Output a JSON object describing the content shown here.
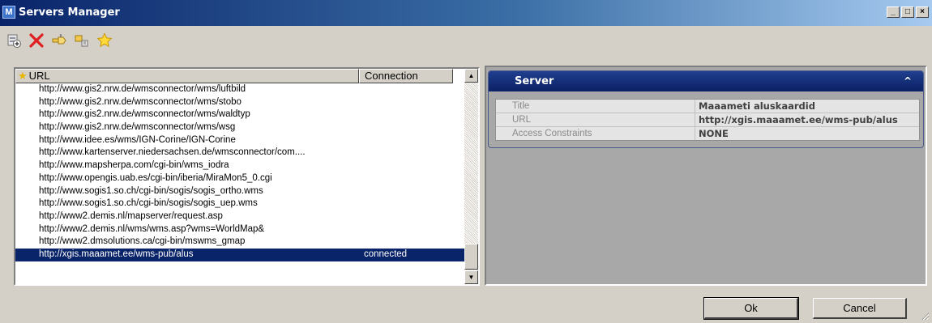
{
  "window": {
    "title": "Servers Manager",
    "controls": [
      "_",
      "□",
      "×"
    ]
  },
  "toolbar": {
    "buttons": [
      {
        "name": "add-server",
        "icon": "add-server-icon"
      },
      {
        "name": "delete-server",
        "icon": "delete-x-icon"
      },
      {
        "name": "connect",
        "icon": "connect-icon"
      },
      {
        "name": "disconnect",
        "icon": "disconnect-icon"
      },
      {
        "name": "favorite",
        "icon": "star-icon"
      }
    ]
  },
  "server_list": {
    "columns": {
      "url": "URL",
      "connection": "Connection"
    },
    "rows": [
      {
        "url": "http://www.gis2.nrw.de/wmsconnector/wms/luftbild",
        "connection": ""
      },
      {
        "url": "http://www.gis2.nrw.de/wmsconnector/wms/stobo",
        "connection": ""
      },
      {
        "url": "http://www.gis2.nrw.de/wmsconnector/wms/waldtyp",
        "connection": ""
      },
      {
        "url": "http://www.gis2.nrw.de/wmsconnector/wms/wsg",
        "connection": ""
      },
      {
        "url": "http://www.idee.es/wms/IGN-Corine/IGN-Corine",
        "connection": ""
      },
      {
        "url": "http://www.kartenserver.niedersachsen.de/wmsconnector/com....",
        "connection": ""
      },
      {
        "url": "http://www.mapsherpa.com/cgi-bin/wms_iodra",
        "connection": ""
      },
      {
        "url": "http://www.opengis.uab.es/cgi-bin/iberia/MiraMon5_0.cgi",
        "connection": ""
      },
      {
        "url": "http://www.sogis1.so.ch/cgi-bin/sogis/sogis_ortho.wms",
        "connection": ""
      },
      {
        "url": "http://www.sogis1.so.ch/cgi-bin/sogis/sogis_uep.wms",
        "connection": ""
      },
      {
        "url": "http://www2.demis.nl/mapserver/request.asp",
        "connection": ""
      },
      {
        "url": "http://www2.demis.nl/wms/wms.asp?wms=WorldMap&",
        "connection": ""
      },
      {
        "url": "http://www2.dmsolutions.ca/cgi-bin/mswms_gmap",
        "connection": ""
      },
      {
        "url": "http://xgis.maaamet.ee/wms-pub/alus",
        "connection": "connected",
        "selected": true
      }
    ]
  },
  "server_panel": {
    "header": "Server",
    "properties": [
      {
        "key": "Title",
        "value": "Maaameti aluskaardid"
      },
      {
        "key": "URL",
        "value": "http://xgis.maaamet.ee/wms-pub/alus"
      },
      {
        "key": "Access Constraints",
        "value": "NONE"
      }
    ]
  },
  "buttons": {
    "ok": "Ok",
    "cancel": "Cancel"
  }
}
